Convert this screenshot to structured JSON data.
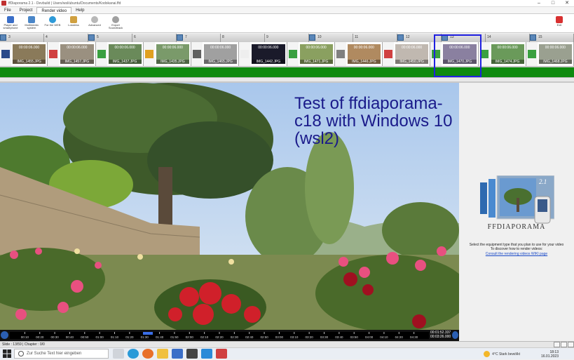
{
  "window": {
    "title": "ffDiaporama 2.1 - Devbuild | Users/wsl/ubuntu/Documents/Kodokanai.ffd",
    "min": "–",
    "max": "□",
    "close": "✕"
  },
  "menu": {
    "tabs": [
      {
        "label": "File"
      },
      {
        "label": "Project"
      },
      {
        "label": "Render video"
      },
      {
        "label": "Help"
      }
    ]
  },
  "ribbon": {
    "buttons": [
      {
        "label": "Player and smartphone",
        "icon": "phone-icon",
        "color": "#3a6ec8"
      },
      {
        "label": "Multimedia system",
        "icon": "tv-icon",
        "color": "#4a86c8"
      },
      {
        "label": "For the WEB",
        "icon": "globe-icon",
        "color": "#2e9ad8"
      },
      {
        "label": "Lossless",
        "icon": "lossless-icon",
        "color": "#d0a040"
      },
      {
        "label": "Advanced",
        "icon": "gear-icon",
        "color": "#b8b8b8"
      },
      {
        "label": "Export Soundtrack",
        "icon": "soundtrack-icon",
        "color": "#a0a0a0"
      }
    ],
    "exit": {
      "label": "Exit",
      "icon": "exit-icon"
    }
  },
  "timeline": {
    "ruler": [
      "3",
      "4",
      "5",
      "6",
      "7",
      "8",
      "9",
      "10",
      "11",
      "12",
      "13",
      "14",
      "15"
    ],
    "slides": [
      {
        "duration": "00:00:06.000",
        "file": "IMG_1455.JPG",
        "color": "#8a7a5a"
      },
      {
        "duration": "00:00:06.000",
        "file": "IMG_1457.JPG",
        "color": "#9a9080"
      },
      {
        "duration": "00:00:06.000",
        "file": "IMG_1437.JPG",
        "color": "#6a8a5a"
      },
      {
        "duration": "00:00:06.000",
        "file": "IMG_1435.JPG",
        "color": "#7a9a6a"
      },
      {
        "duration": "00:00:06.000",
        "file": "IMG_1465.JPG",
        "color": "#a0a0a0"
      },
      {
        "duration": "00:00:06.000",
        "file": "IMG_1442.JPG",
        "color": "#1a1a2a"
      },
      {
        "duration": "00:00:06.000",
        "file": "IMG_1471.JPG",
        "color": "#8aa060"
      },
      {
        "duration": "00:00:06.000",
        "file": "IMG_1446.JPG",
        "color": "#b08a60"
      },
      {
        "duration": "00:00:06.000",
        "file": "IMG_1450.JPG",
        "color": "#c0b8b0"
      },
      {
        "duration": "00:00:06.000",
        "file": "IMG_1470.JPG",
        "color": "#8a80a0"
      },
      {
        "duration": "00:00:06.000",
        "file": "IMG_1474.JPG",
        "color": "#6a9a5a"
      },
      {
        "duration": "00:00:06.000",
        "file": "IMG_1468.JPG",
        "color": "#9aa090"
      }
    ]
  },
  "viewer": {
    "title": "Test of ffdiaporama-c18 with Windows 10 (wsl2)"
  },
  "side": {
    "logo_text": "FFDIAPORAMA",
    "logo_version": "2.1",
    "hint1": "Select the equipment type that you plan to use for your video",
    "hint2": "To discover how to render videos:",
    "link": "Consult the rendering videos WIKI page"
  },
  "player": {
    "ticks": [
      "00:10",
      "00:20",
      "00:30",
      "00:40",
      "00:50",
      "01:00",
      "01:10",
      "01:20",
      "01:30",
      "01:40",
      "01:50",
      "02:00",
      "02:10",
      "02:20",
      "02:30",
      "02:40",
      "02:50",
      "03:00",
      "03:10",
      "03:20",
      "03:30",
      "03:40",
      "03:50",
      "04:00",
      "04:10",
      "04:20",
      "04:30"
    ],
    "time_current": "00:01:52.337",
    "time_total": "00:03:26.000"
  },
  "status": {
    "text": "Slide : 13/59 | Chapter : 0/0"
  },
  "taskbar": {
    "search_placeholder": "Zur Suche Text hier eingeben",
    "weather": "4°C  Stark bewölkt",
    "time": "18:13",
    "date": "16.01.2023"
  }
}
